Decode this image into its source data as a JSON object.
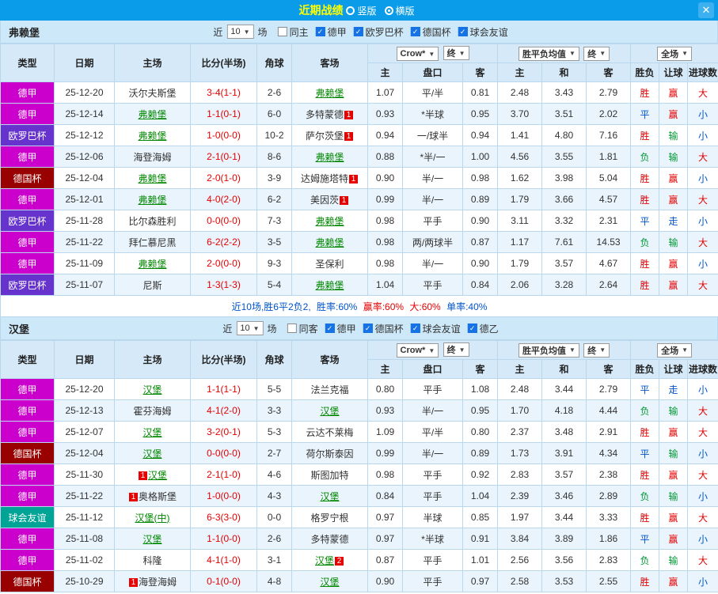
{
  "palette": {
    "red": "#e60000",
    "green": "#009933",
    "blue": "#0055cc",
    "focus_team": "#008800"
  },
  "league_colors": {
    "德甲": "#cc00cc",
    "欧罗巴杯": "#6633cc",
    "德国杯": "#990000",
    "球会友谊": "#00a496"
  },
  "topbar": {
    "title": "近期战绩",
    "vertical_label": "竖版",
    "horizontal_label": "横版",
    "close_icon": "✕"
  },
  "filter_labels": {
    "recent": "近",
    "games": "场"
  },
  "table_controls": {
    "odds_source": "Crow*",
    "odds_state": "终",
    "europe_source": "胜平负均值",
    "europe_state": "终",
    "scope": "全场"
  },
  "columns": {
    "type": "类型",
    "date": "日期",
    "home": "主场",
    "score": "比分(半场)",
    "corner": "角球",
    "away": "客场",
    "asia_home": "主",
    "handicap": "盘口",
    "asia_away": "客",
    "euro_home": "主",
    "euro_draw": "和",
    "euro_away": "客",
    "result": "胜负",
    "handicap_result": "让球",
    "goals": "进球数"
  },
  "sections": [
    {
      "team": "弗赖堡",
      "filters": {
        "count": "10",
        "same_label": "同主",
        "same_checked": false,
        "leagues": [
          "德甲",
          "欧罗巴杯",
          "德国杯",
          "球会友谊"
        ]
      },
      "rows": [
        {
          "league": "德甲",
          "date": "25-12-20",
          "home": "沃尔夫斯堡",
          "home_focus": false,
          "home_badge_before": "",
          "home_badge_after": "",
          "score": "3-4(1-1)",
          "corner": "2-6",
          "away": "弗赖堡",
          "away_focus": true,
          "away_badge_before": "",
          "away_badge_after": "",
          "asia_home": "1.07",
          "handicap": "平/半",
          "asia_away": "0.81",
          "euro_home": "2.48",
          "euro_draw": "3.43",
          "euro_away": "2.79",
          "result": "胜",
          "result_color": "red",
          "handicap_result": "赢",
          "handicap_result_color": "red",
          "goals": "大",
          "goals_color": "red"
        },
        {
          "league": "德甲",
          "date": "25-12-14",
          "home": "弗赖堡",
          "home_focus": true,
          "home_badge_before": "",
          "home_badge_after": "",
          "score": "1-1(0-1)",
          "corner": "6-0",
          "away": "多特蒙德",
          "away_focus": false,
          "away_badge_before": "",
          "away_badge_after": "1",
          "asia_home": "0.93",
          "handicap": "*半球",
          "asia_away": "0.95",
          "euro_home": "3.70",
          "euro_draw": "3.51",
          "euro_away": "2.02",
          "result": "平",
          "result_color": "blue",
          "handicap_result": "赢",
          "handicap_result_color": "red",
          "goals": "小",
          "goals_color": "blue"
        },
        {
          "league": "欧罗巴杯",
          "date": "25-12-12",
          "home": "弗赖堡",
          "home_focus": true,
          "home_badge_before": "",
          "home_badge_after": "",
          "score": "1-0(0-0)",
          "corner": "10-2",
          "away": "萨尔茨堡",
          "away_focus": false,
          "away_badge_before": "",
          "away_badge_after": "1",
          "asia_home": "0.94",
          "handicap": "一/球半",
          "asia_away": "0.94",
          "euro_home": "1.41",
          "euro_draw": "4.80",
          "euro_away": "7.16",
          "result": "胜",
          "result_color": "red",
          "handicap_result": "输",
          "handicap_result_color": "green",
          "goals": "小",
          "goals_color": "blue"
        },
        {
          "league": "德甲",
          "date": "25-12-06",
          "home": "海登海姆",
          "home_focus": false,
          "home_badge_before": "",
          "home_badge_after": "",
          "score": "2-1(0-1)",
          "corner": "8-6",
          "away": "弗赖堡",
          "away_focus": true,
          "away_badge_before": "",
          "away_badge_after": "",
          "asia_home": "0.88",
          "handicap": "*半/一",
          "asia_away": "1.00",
          "euro_home": "4.56",
          "euro_draw": "3.55",
          "euro_away": "1.81",
          "result": "负",
          "result_color": "green",
          "handicap_result": "输",
          "handicap_result_color": "green",
          "goals": "大",
          "goals_color": "red"
        },
        {
          "league": "德国杯",
          "date": "25-12-04",
          "home": "弗赖堡",
          "home_focus": true,
          "home_badge_before": "",
          "home_badge_after": "",
          "score": "2-0(1-0)",
          "corner": "3-9",
          "away": "达姆施塔特",
          "away_focus": false,
          "away_badge_before": "",
          "away_badge_after": "1",
          "asia_home": "0.90",
          "handicap": "半/一",
          "asia_away": "0.98",
          "euro_home": "1.62",
          "euro_draw": "3.98",
          "euro_away": "5.04",
          "result": "胜",
          "result_color": "red",
          "handicap_result": "赢",
          "handicap_result_color": "red",
          "goals": "小",
          "goals_color": "blue"
        },
        {
          "league": "德甲",
          "date": "25-12-01",
          "home": "弗赖堡",
          "home_focus": true,
          "home_badge_before": "",
          "home_badge_after": "",
          "score": "4-0(2-0)",
          "corner": "6-2",
          "away": "美因茨",
          "away_focus": false,
          "away_badge_before": "",
          "away_badge_after": "1",
          "asia_home": "0.99",
          "handicap": "半/一",
          "asia_away": "0.89",
          "euro_home": "1.79",
          "euro_draw": "3.66",
          "euro_away": "4.57",
          "result": "胜",
          "result_color": "red",
          "handicap_result": "赢",
          "handicap_result_color": "red",
          "goals": "大",
          "goals_color": "red"
        },
        {
          "league": "欧罗巴杯",
          "date": "25-11-28",
          "home": "比尔森胜利",
          "home_focus": false,
          "home_badge_before": "",
          "home_badge_after": "",
          "score": "0-0(0-0)",
          "corner": "7-3",
          "away": "弗赖堡",
          "away_focus": true,
          "away_badge_before": "",
          "away_badge_after": "",
          "asia_home": "0.98",
          "handicap": "平手",
          "asia_away": "0.90",
          "euro_home": "3.11",
          "euro_draw": "3.32",
          "euro_away": "2.31",
          "result": "平",
          "result_color": "blue",
          "handicap_result": "走",
          "handicap_result_color": "blue",
          "goals": "小",
          "goals_color": "blue"
        },
        {
          "league": "德甲",
          "date": "25-11-22",
          "home": "拜仁慕尼黑",
          "home_focus": false,
          "home_badge_before": "",
          "home_badge_after": "",
          "score": "6-2(2-2)",
          "corner": "3-5",
          "away": "弗赖堡",
          "away_focus": true,
          "away_badge_before": "",
          "away_badge_after": "",
          "asia_home": "0.98",
          "handicap": "两/两球半",
          "asia_away": "0.87",
          "euro_home": "1.17",
          "euro_draw": "7.61",
          "euro_away": "14.53",
          "result": "负",
          "result_color": "green",
          "handicap_result": "输",
          "handicap_result_color": "green",
          "goals": "大",
          "goals_color": "red"
        },
        {
          "league": "德甲",
          "date": "25-11-09",
          "home": "弗赖堡",
          "home_focus": true,
          "home_badge_before": "",
          "home_badge_after": "",
          "score": "2-0(0-0)",
          "corner": "9-3",
          "away": "圣保利",
          "away_focus": false,
          "away_badge_before": "",
          "away_badge_after": "",
          "asia_home": "0.98",
          "handicap": "半/一",
          "asia_away": "0.90",
          "euro_home": "1.79",
          "euro_draw": "3.57",
          "euro_away": "4.67",
          "result": "胜",
          "result_color": "red",
          "handicap_result": "赢",
          "handicap_result_color": "red",
          "goals": "小",
          "goals_color": "blue"
        },
        {
          "league": "欧罗巴杯",
          "date": "25-11-07",
          "home": "尼斯",
          "home_focus": false,
          "home_badge_before": "",
          "home_badge_after": "",
          "score": "1-3(1-3)",
          "corner": "5-4",
          "away": "弗赖堡",
          "away_focus": true,
          "away_badge_before": "",
          "away_badge_after": "",
          "asia_home": "1.04",
          "handicap": "平手",
          "asia_away": "0.84",
          "euro_home": "2.06",
          "euro_draw": "3.28",
          "euro_away": "2.64",
          "result": "胜",
          "result_color": "red",
          "handicap_result": "赢",
          "handicap_result_color": "red",
          "goals": "大",
          "goals_color": "red"
        }
      ],
      "summary": [
        {
          "text": "近10场,胜6平2负2, ",
          "color": "blue"
        },
        {
          "text": "胜率:60% ",
          "color": "blue"
        },
        {
          "text": "赢率:60% ",
          "color": "red"
        },
        {
          "text": "大:60% ",
          "color": "red"
        },
        {
          "text": "单率:40%",
          "color": "blue"
        }
      ]
    },
    {
      "team": "汉堡",
      "filters": {
        "count": "10",
        "same_label": "同客",
        "same_checked": false,
        "leagues": [
          "德甲",
          "德国杯",
          "球会友谊",
          "德乙"
        ]
      },
      "rows": [
        {
          "league": "德甲",
          "date": "25-12-20",
          "home": "汉堡",
          "home_focus": true,
          "home_badge_before": "",
          "home_badge_after": "",
          "score": "1-1(1-1)",
          "corner": "5-5",
          "away": "法兰克福",
          "away_focus": false,
          "away_badge_before": "",
          "away_badge_after": "",
          "asia_home": "0.80",
          "handicap": "平手",
          "asia_away": "1.08",
          "euro_home": "2.48",
          "euro_draw": "3.44",
          "euro_away": "2.79",
          "result": "平",
          "result_color": "blue",
          "handicap_result": "走",
          "handicap_result_color": "blue",
          "goals": "小",
          "goals_color": "blue"
        },
        {
          "league": "德甲",
          "date": "25-12-13",
          "home": "霍芬海姆",
          "home_focus": false,
          "home_badge_before": "",
          "home_badge_after": "",
          "score": "4-1(2-0)",
          "corner": "3-3",
          "away": "汉堡",
          "away_focus": true,
          "away_badge_before": "",
          "away_badge_after": "",
          "asia_home": "0.93",
          "handicap": "半/一",
          "asia_away": "0.95",
          "euro_home": "1.70",
          "euro_draw": "4.18",
          "euro_away": "4.44",
          "result": "负",
          "result_color": "green",
          "handicap_result": "输",
          "handicap_result_color": "green",
          "goals": "大",
          "goals_color": "red"
        },
        {
          "league": "德甲",
          "date": "25-12-07",
          "home": "汉堡",
          "home_focus": true,
          "home_badge_before": "",
          "home_badge_after": "",
          "score": "3-2(0-1)",
          "corner": "5-3",
          "away": "云达不莱梅",
          "away_focus": false,
          "away_badge_before": "",
          "away_badge_after": "",
          "asia_home": "1.09",
          "handicap": "平/半",
          "asia_away": "0.80",
          "euro_home": "2.37",
          "euro_draw": "3.48",
          "euro_away": "2.91",
          "result": "胜",
          "result_color": "red",
          "handicap_result": "赢",
          "handicap_result_color": "red",
          "goals": "大",
          "goals_color": "red"
        },
        {
          "league": "德国杯",
          "date": "25-12-04",
          "home": "汉堡",
          "home_focus": true,
          "home_badge_before": "",
          "home_badge_after": "",
          "score": "0-0(0-0)",
          "corner": "2-7",
          "away": "荷尔斯泰因",
          "away_focus": false,
          "away_badge_before": "",
          "away_badge_after": "",
          "asia_home": "0.99",
          "handicap": "半/一",
          "asia_away": "0.89",
          "euro_home": "1.73",
          "euro_draw": "3.91",
          "euro_away": "4.34",
          "result": "平",
          "result_color": "blue",
          "handicap_result": "输",
          "handicap_result_color": "green",
          "goals": "小",
          "goals_color": "blue"
        },
        {
          "league": "德甲",
          "date": "25-11-30",
          "home": "汉堡",
          "home_focus": true,
          "home_badge_before": "1",
          "home_badge_after": "",
          "score": "2-1(1-0)",
          "corner": "4-6",
          "away": "斯图加特",
          "away_focus": false,
          "away_badge_before": "",
          "away_badge_after": "",
          "asia_home": "0.98",
          "handicap": "平手",
          "asia_away": "0.92",
          "euro_home": "2.83",
          "euro_draw": "3.57",
          "euro_away": "2.38",
          "result": "胜",
          "result_color": "red",
          "handicap_result": "赢",
          "handicap_result_color": "red",
          "goals": "大",
          "goals_color": "red"
        },
        {
          "league": "德甲",
          "date": "25-11-22",
          "home": "奥格斯堡",
          "home_focus": false,
          "home_badge_before": "1",
          "home_badge_after": "",
          "score": "1-0(0-0)",
          "corner": "4-3",
          "away": "汉堡",
          "away_focus": true,
          "away_badge_before": "",
          "away_badge_after": "",
          "asia_home": "0.84",
          "handicap": "平手",
          "asia_away": "1.04",
          "euro_home": "2.39",
          "euro_draw": "3.46",
          "euro_away": "2.89",
          "result": "负",
          "result_color": "green",
          "handicap_result": "输",
          "handicap_result_color": "green",
          "goals": "小",
          "goals_color": "blue"
        },
        {
          "league": "球会友谊",
          "date": "25-11-12",
          "home": "汉堡(中)",
          "home_focus": true,
          "home_badge_before": "",
          "home_badge_after": "",
          "score": "6-3(3-0)",
          "corner": "0-0",
          "away": "格罗宁根",
          "away_focus": false,
          "away_badge_before": "",
          "away_badge_after": "",
          "asia_home": "0.97",
          "handicap": "半球",
          "asia_away": "0.85",
          "euro_home": "1.97",
          "euro_draw": "3.44",
          "euro_away": "3.33",
          "result": "胜",
          "result_color": "red",
          "handicap_result": "赢",
          "handicap_result_color": "red",
          "goals": "大",
          "goals_color": "red"
        },
        {
          "league": "德甲",
          "date": "25-11-08",
          "home": "汉堡",
          "home_focus": true,
          "home_badge_before": "",
          "home_badge_after": "",
          "score": "1-1(0-0)",
          "corner": "2-6",
          "away": "多特蒙德",
          "away_focus": false,
          "away_badge_before": "",
          "away_badge_after": "",
          "asia_home": "0.97",
          "handicap": "*半球",
          "asia_away": "0.91",
          "euro_home": "3.84",
          "euro_draw": "3.89",
          "euro_away": "1.86",
          "result": "平",
          "result_color": "blue",
          "handicap_result": "赢",
          "handicap_result_color": "red",
          "goals": "小",
          "goals_color": "blue"
        },
        {
          "league": "德甲",
          "date": "25-11-02",
          "home": "科隆",
          "home_focus": false,
          "home_badge_before": "",
          "home_badge_after": "",
          "score": "4-1(1-0)",
          "corner": "3-1",
          "away": "汉堡",
          "away_focus": true,
          "away_badge_before": "",
          "away_badge_after": "2",
          "asia_home": "0.87",
          "handicap": "平手",
          "asia_away": "1.01",
          "euro_home": "2.56",
          "euro_draw": "3.56",
          "euro_away": "2.83",
          "result": "负",
          "result_color": "green",
          "handicap_result": "输",
          "handicap_result_color": "green",
          "goals": "大",
          "goals_color": "red"
        },
        {
          "league": "德国杯",
          "date": "25-10-29",
          "home": "海登海姆",
          "home_focus": false,
          "home_badge_before": "1",
          "home_badge_after": "",
          "score": "0-1(0-0)",
          "corner": "4-8",
          "away": "汉堡",
          "away_focus": true,
          "away_badge_before": "",
          "away_badge_after": "",
          "asia_home": "0.90",
          "handicap": "平手",
          "asia_away": "0.97",
          "euro_home": "2.58",
          "euro_draw": "3.53",
          "euro_away": "2.55",
          "result": "胜",
          "result_color": "red",
          "handicap_result": "赢",
          "handicap_result_color": "red",
          "goals": "小",
          "goals_color": "blue"
        }
      ]
    }
  ]
}
